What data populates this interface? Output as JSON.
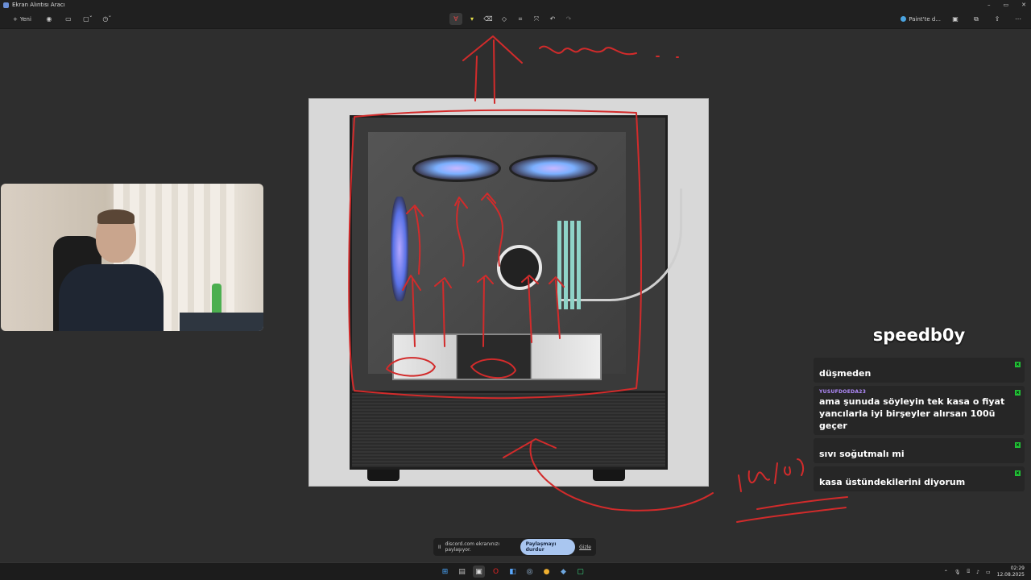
{
  "window": {
    "title": "Ekran Alıntısı Aracı",
    "minimize": "–",
    "maximize": "▭",
    "close": "✕"
  },
  "toolbar": {
    "new_label": "Yeni",
    "paint_label": "Paint'te d...",
    "more": "⋯"
  },
  "chat": {
    "streamer": "speedb0y",
    "messages": [
      {
        "user": "",
        "user_color": "#ff3b3b",
        "text": "düşmeden"
      },
      {
        "user": "YUSUFDOEDA23",
        "user_color": "#b38cff",
        "text": "ama şunuda söyleyin tek kasa o fiyat yancılarla iyi birşeyler alırsan 100ü geçer"
      },
      {
        "user": "",
        "user_color": "#ff3b3b",
        "text": "sıvı soğutmalı mi"
      },
      {
        "user": "",
        "user_color": "#ff3b3b",
        "text": "kasa üstündekilerini diyorum"
      }
    ]
  },
  "share_bar": {
    "pause": "II",
    "message": "discord.com ekranınızı paylaşıyor.",
    "stop_label": "Paylaşmayı durdur",
    "hide_label": "Gizle"
  },
  "taskbar": {
    "time": "02:29",
    "date": "12.08.2025"
  },
  "colors": {
    "ink": "#d22b2b",
    "accent": "#21c236"
  }
}
